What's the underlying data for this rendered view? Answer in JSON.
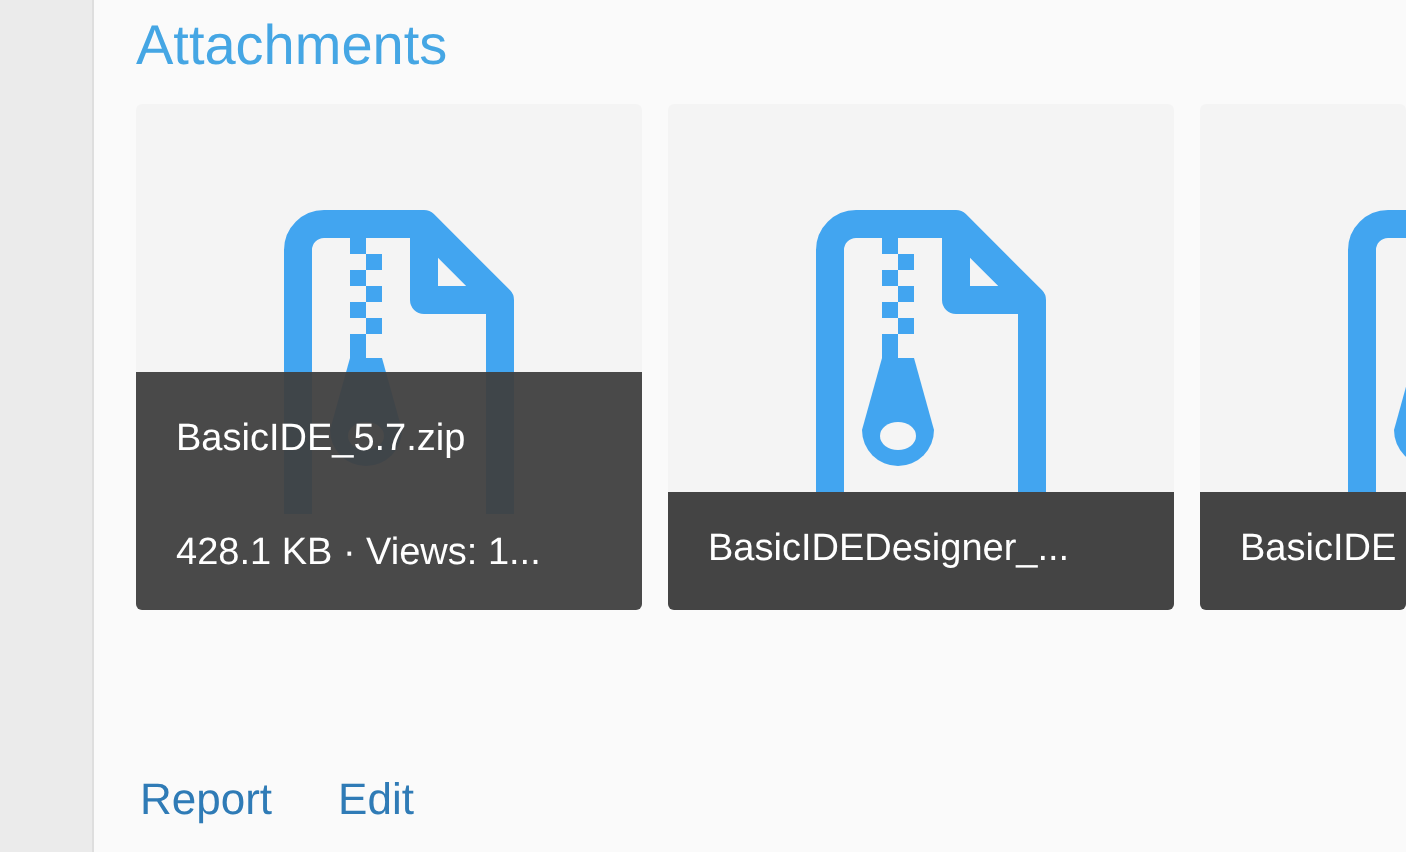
{
  "heading": "Attachments",
  "attachments": [
    {
      "name": "BasicIDE_5.7.zip",
      "meta": "428.1 KB · Views: 1...",
      "expanded": true
    },
    {
      "name": "BasicIDEDesigner_...",
      "expanded": false
    },
    {
      "name": "BasicIDE",
      "expanded": false
    }
  ],
  "links": [
    "Report",
    "Edit"
  ]
}
